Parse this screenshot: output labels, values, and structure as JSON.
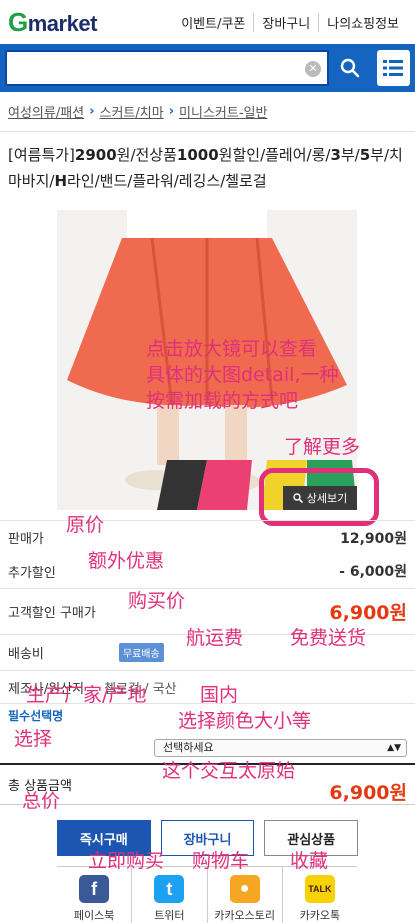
{
  "header": {
    "logo_g": "G",
    "logo_rest": "market",
    "links": [
      "이벤트/쿠폰",
      "장바구니",
      "나의쇼핑정보"
    ]
  },
  "search": {
    "value": "",
    "placeholder": ""
  },
  "breadcrumb": [
    "여성의류/패션",
    "스커트/치마",
    "미니스커트-일반"
  ],
  "product": {
    "title_parts": [
      "[여름특가]",
      "2900",
      "원/전상품",
      "1000",
      "원할인/플레어/롱/",
      "3",
      "부/",
      "5",
      "부/치마바지/",
      "H",
      "라인/밴드/플라워/레깅스/첼로걸"
    ],
    "zoom_label": "상세보기"
  },
  "prices": {
    "list_label": "판매가",
    "list_value": "12,900원",
    "extra_label": "추가할인",
    "extra_value": "- 6,000원",
    "buy_label": "고객할인 구매가",
    "buy_value": "6,900원",
    "ship_label": "배송비",
    "ship_badge": "무료배송",
    "maker_label": "제조사/원산지",
    "maker_value": "첼로걸 / 국산"
  },
  "option": {
    "label": "필수선택명",
    "select_value": "선택하세요"
  },
  "total": {
    "label": "총 상품금액",
    "value": "6,900원"
  },
  "buttons": {
    "buy": "즉시구매",
    "cart": "장바구니",
    "wish": "관심상품"
  },
  "share": [
    {
      "label": "페이스북",
      "icon": "facebook-icon",
      "glyph": "f",
      "color": "#3b5998"
    },
    {
      "label": "트위터",
      "icon": "twitter-icon",
      "glyph": "t",
      "color": "#1da1f2"
    },
    {
      "label": "카카오스토리",
      "icon": "kakaostory-icon",
      "glyph": "●",
      "color": "#f5a623"
    },
    {
      "label": "카카오톡",
      "icon": "kakaotalk-icon",
      "glyph": "TALK",
      "color": "#f7d100"
    }
  ],
  "annotations": {
    "zoom": "点击放大镜可以查看\n具体的大图detail,一种\n按需加载的方式吧",
    "more": "了解更多",
    "list_price": "原价",
    "extra": "额外优惠",
    "buy_price": "购买价",
    "shipping": "航运费",
    "free": "免费送货",
    "maker": "生产厂家/产地",
    "domestic": "国内",
    "color_size": "选择颜色大小等",
    "choose": "选择",
    "unstable": "这个交互太原始",
    "total": "总价",
    "buy_now": "立即购买",
    "cart": "购物车",
    "favorite": "收藏"
  },
  "colors": {
    "brand_blue": "#1565c0",
    "price_red": "#e53a11",
    "note_pink": "#e0307a",
    "logo_green": "#1fa045"
  }
}
